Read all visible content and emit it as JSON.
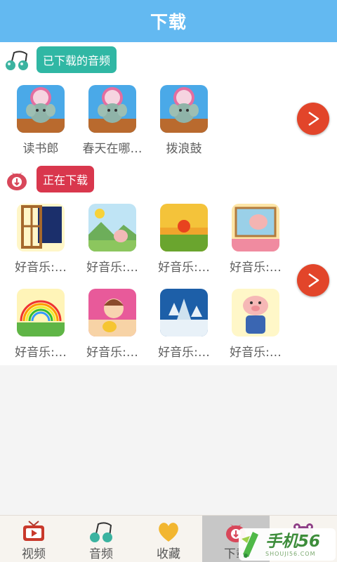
{
  "header": {
    "title": "下载"
  },
  "downloaded": {
    "label": "已下载的音频",
    "items": [
      {
        "title": "读书郎"
      },
      {
        "title": "春天在哪…"
      },
      {
        "title": "拨浪鼓"
      }
    ]
  },
  "downloading": {
    "label": "正在下载",
    "items": [
      {
        "title": "好音乐:…"
      },
      {
        "title": "好音乐:…"
      },
      {
        "title": "好音乐:…"
      },
      {
        "title": "好音乐:…"
      },
      {
        "title": "好音乐:…"
      },
      {
        "title": "好音乐:…"
      },
      {
        "title": "好音乐:…"
      },
      {
        "title": "好音乐:…"
      }
    ]
  },
  "tabs": [
    {
      "label": "视频",
      "icon": "tv-icon"
    },
    {
      "label": "音频",
      "icon": "music-note-icon"
    },
    {
      "label": "收藏",
      "icon": "heart-icon"
    },
    {
      "label": "下载",
      "icon": "download-icon",
      "active": true
    },
    {
      "label": "",
      "icon": "frog-icon"
    }
  ],
  "watermark": {
    "text": "手机56",
    "subtext": "SHOUJI56.COM"
  },
  "colors": {
    "header": "#63b9f1",
    "downloaded_label": "#30b7a4",
    "downloading_label": "#d9374d",
    "more_button": "#e2452a"
  }
}
